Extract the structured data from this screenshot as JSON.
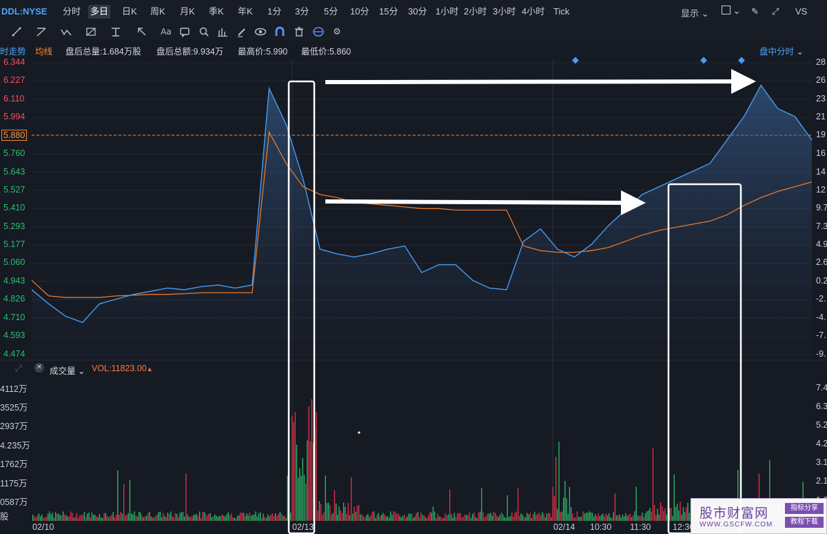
{
  "header": {
    "symbol": "DDL:NYSE",
    "timeframes": [
      {
        "label": "分时",
        "active": false
      },
      {
        "label": "多日",
        "active": true
      },
      {
        "label": "日K",
        "active": false
      },
      {
        "label": "周K",
        "active": false
      },
      {
        "label": "月K",
        "active": false
      },
      {
        "label": "季K",
        "active": false
      },
      {
        "label": "年K",
        "active": false
      },
      {
        "label": "1分",
        "active": false
      },
      {
        "label": "3分",
        "active": false
      },
      {
        "label": "5分",
        "active": false
      },
      {
        "label": "10分",
        "active": false
      },
      {
        "label": "15分",
        "active": false
      },
      {
        "label": "30分",
        "active": false
      },
      {
        "label": "1小时",
        "active": false
      },
      {
        "label": "2小时",
        "active": false
      },
      {
        "label": "3小时",
        "active": false
      },
      {
        "label": "4小时",
        "active": false
      },
      {
        "label": "Tick",
        "active": false
      }
    ],
    "display_label": "显示",
    "vs_label": "VS"
  },
  "toolbar": {
    "icons": [
      "line-tool-icon",
      "channel-tool-icon",
      "wave-tool-icon",
      "pattern-tool-icon",
      "fib-tool-icon",
      "arrow-tool-icon",
      "text-tool-icon",
      "comment-tool-icon",
      "zoom-tool-icon",
      "measure-tool-icon",
      "brush-tool-icon",
      "eye-icon",
      "magnet-icon",
      "trash-icon",
      "sync-icon",
      "gear-icon"
    ],
    "text_icon_label": "Aa"
  },
  "info": {
    "tab_trend": "时走势",
    "tab_avg": "均线",
    "after_hours_volume": "盘后总量:1.684万股",
    "after_hours_amount": "盘后总额:9.934万",
    "high": "最高价:5.990",
    "low": "最低价:5.860",
    "intraday_label": "盘中分时"
  },
  "price_axis": {
    "labels": [
      "6.344",
      "6.227",
      "6.110",
      "5.994",
      "5.880",
      "5.760",
      "5.643",
      "5.527",
      "5.410",
      "5.293",
      "5.177",
      "5.060",
      "4.943",
      "4.826",
      "4.710",
      "4.593",
      "4.474"
    ],
    "prev_close": "5.880",
    "right_labels": [
      "28",
      "26",
      "23",
      "21",
      "19",
      "16",
      "14",
      "12",
      "9.7",
      "7.3",
      "4.9",
      "2.6",
      "0.2",
      "-2.",
      "-4.",
      "-7.",
      "-9."
    ]
  },
  "volume": {
    "title": "成交量",
    "vol_value": "VOL:11823.00",
    "axis_labels": [
      "4112万",
      "3525万",
      "2937万",
      "4.235万",
      "1762万",
      "1175万",
      "0587万",
      "股"
    ],
    "right_labels": [
      "7.4",
      "6.3",
      "5.2",
      "4.2",
      "3.1",
      "2.1",
      "1.0"
    ]
  },
  "x_axis": {
    "labels": [
      "02/10",
      "02/13",
      "02/14",
      "10:30",
      "11:30",
      "12:30"
    ]
  },
  "watermark": {
    "main": "股市财富网",
    "url": "WWW.GSCFW.COM",
    "badge1": "指标分享",
    "badge2": "教程下载"
  },
  "chart_data": {
    "type": "line",
    "x": [
      "02/10",
      "02/13",
      "02/14",
      "10:30",
      "11:30",
      "12:30"
    ],
    "series": [
      {
        "values": [
          4.89,
          4.8,
          4.72,
          4.68,
          4.8,
          4.83,
          4.86,
          4.88,
          4.9,
          4.89,
          4.91,
          4.92,
          4.9,
          4.92,
          6.18,
          5.95,
          5.6,
          5.15,
          5.12,
          5.1,
          5.12,
          5.15,
          5.17,
          5.0,
          5.05,
          5.05,
          4.95,
          4.9,
          4.89,
          5.2,
          5.28,
          5.15,
          5.1,
          5.18,
          5.3,
          5.4,
          5.5,
          5.55,
          5.6,
          5.65,
          5.7,
          5.85,
          6.0,
          6.2,
          6.05,
          6.0,
          5.85
        ]
      },
      {
        "values": [
          4.95,
          4.85,
          4.84,
          4.84,
          4.84,
          4.85,
          4.855,
          4.86,
          4.86,
          4.865,
          4.87,
          4.87,
          4.87,
          4.87,
          5.9,
          5.7,
          5.55,
          5.5,
          5.48,
          5.45,
          5.44,
          5.43,
          5.42,
          5.41,
          5.41,
          5.4,
          5.4,
          5.4,
          5.4,
          5.17,
          5.14,
          5.13,
          5.13,
          5.14,
          5.16,
          5.2,
          5.24,
          5.27,
          5.29,
          5.31,
          5.33,
          5.37,
          5.43,
          5.48,
          5.52,
          5.55,
          5.58
        ]
      }
    ],
    "ylim": [
      4.474,
      6.344
    ],
    "prev_close": 5.88,
    "grid": true,
    "volume_ylim": [
      0,
      4112
    ]
  }
}
